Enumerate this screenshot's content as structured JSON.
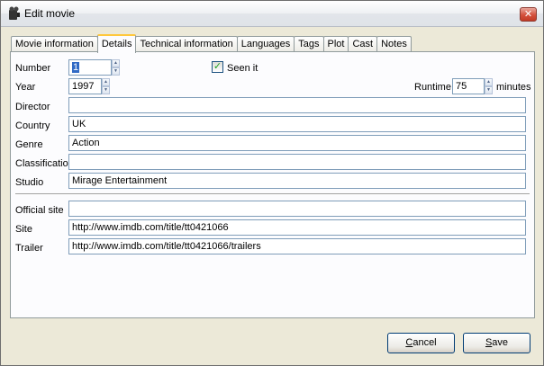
{
  "window": {
    "title": "Edit movie"
  },
  "tabs": [
    {
      "label": "Movie information"
    },
    {
      "label": "Details",
      "active": true
    },
    {
      "label": "Technical information"
    },
    {
      "label": "Languages"
    },
    {
      "label": "Tags"
    },
    {
      "label": "Plot"
    },
    {
      "label": "Cast"
    },
    {
      "label": "Notes"
    }
  ],
  "form": {
    "number_label": "Number",
    "number_value": "1",
    "seen_it_label": "Seen it",
    "seen_it_checked": true,
    "year_label": "Year",
    "year_value": "1997",
    "runtime_label": "Runtime",
    "runtime_value": "75",
    "runtime_unit": "minutes",
    "director_label": "Director",
    "director_value": "",
    "country_label": "Country",
    "country_value": "UK",
    "genre_label": "Genre",
    "genre_value": "Action",
    "classification_label": "Classification",
    "classification_value": "",
    "studio_label": "Studio",
    "studio_value": "Mirage Entertainment",
    "official_site_label": "Official site",
    "official_site_value": "",
    "site_label": "Site",
    "site_value": "http://www.imdb.com/title/tt0421066",
    "trailer_label": "Trailer",
    "trailer_value": "http://www.imdb.com/title/tt0421066/trailers"
  },
  "buttons": {
    "cancel_first": "C",
    "cancel_rest": "ancel",
    "save_first": "S",
    "save_rest": "ave"
  },
  "colors": {
    "selection": "#316ac5",
    "tab_accent": "#ffc83c",
    "field_border": "#7f9db9"
  }
}
